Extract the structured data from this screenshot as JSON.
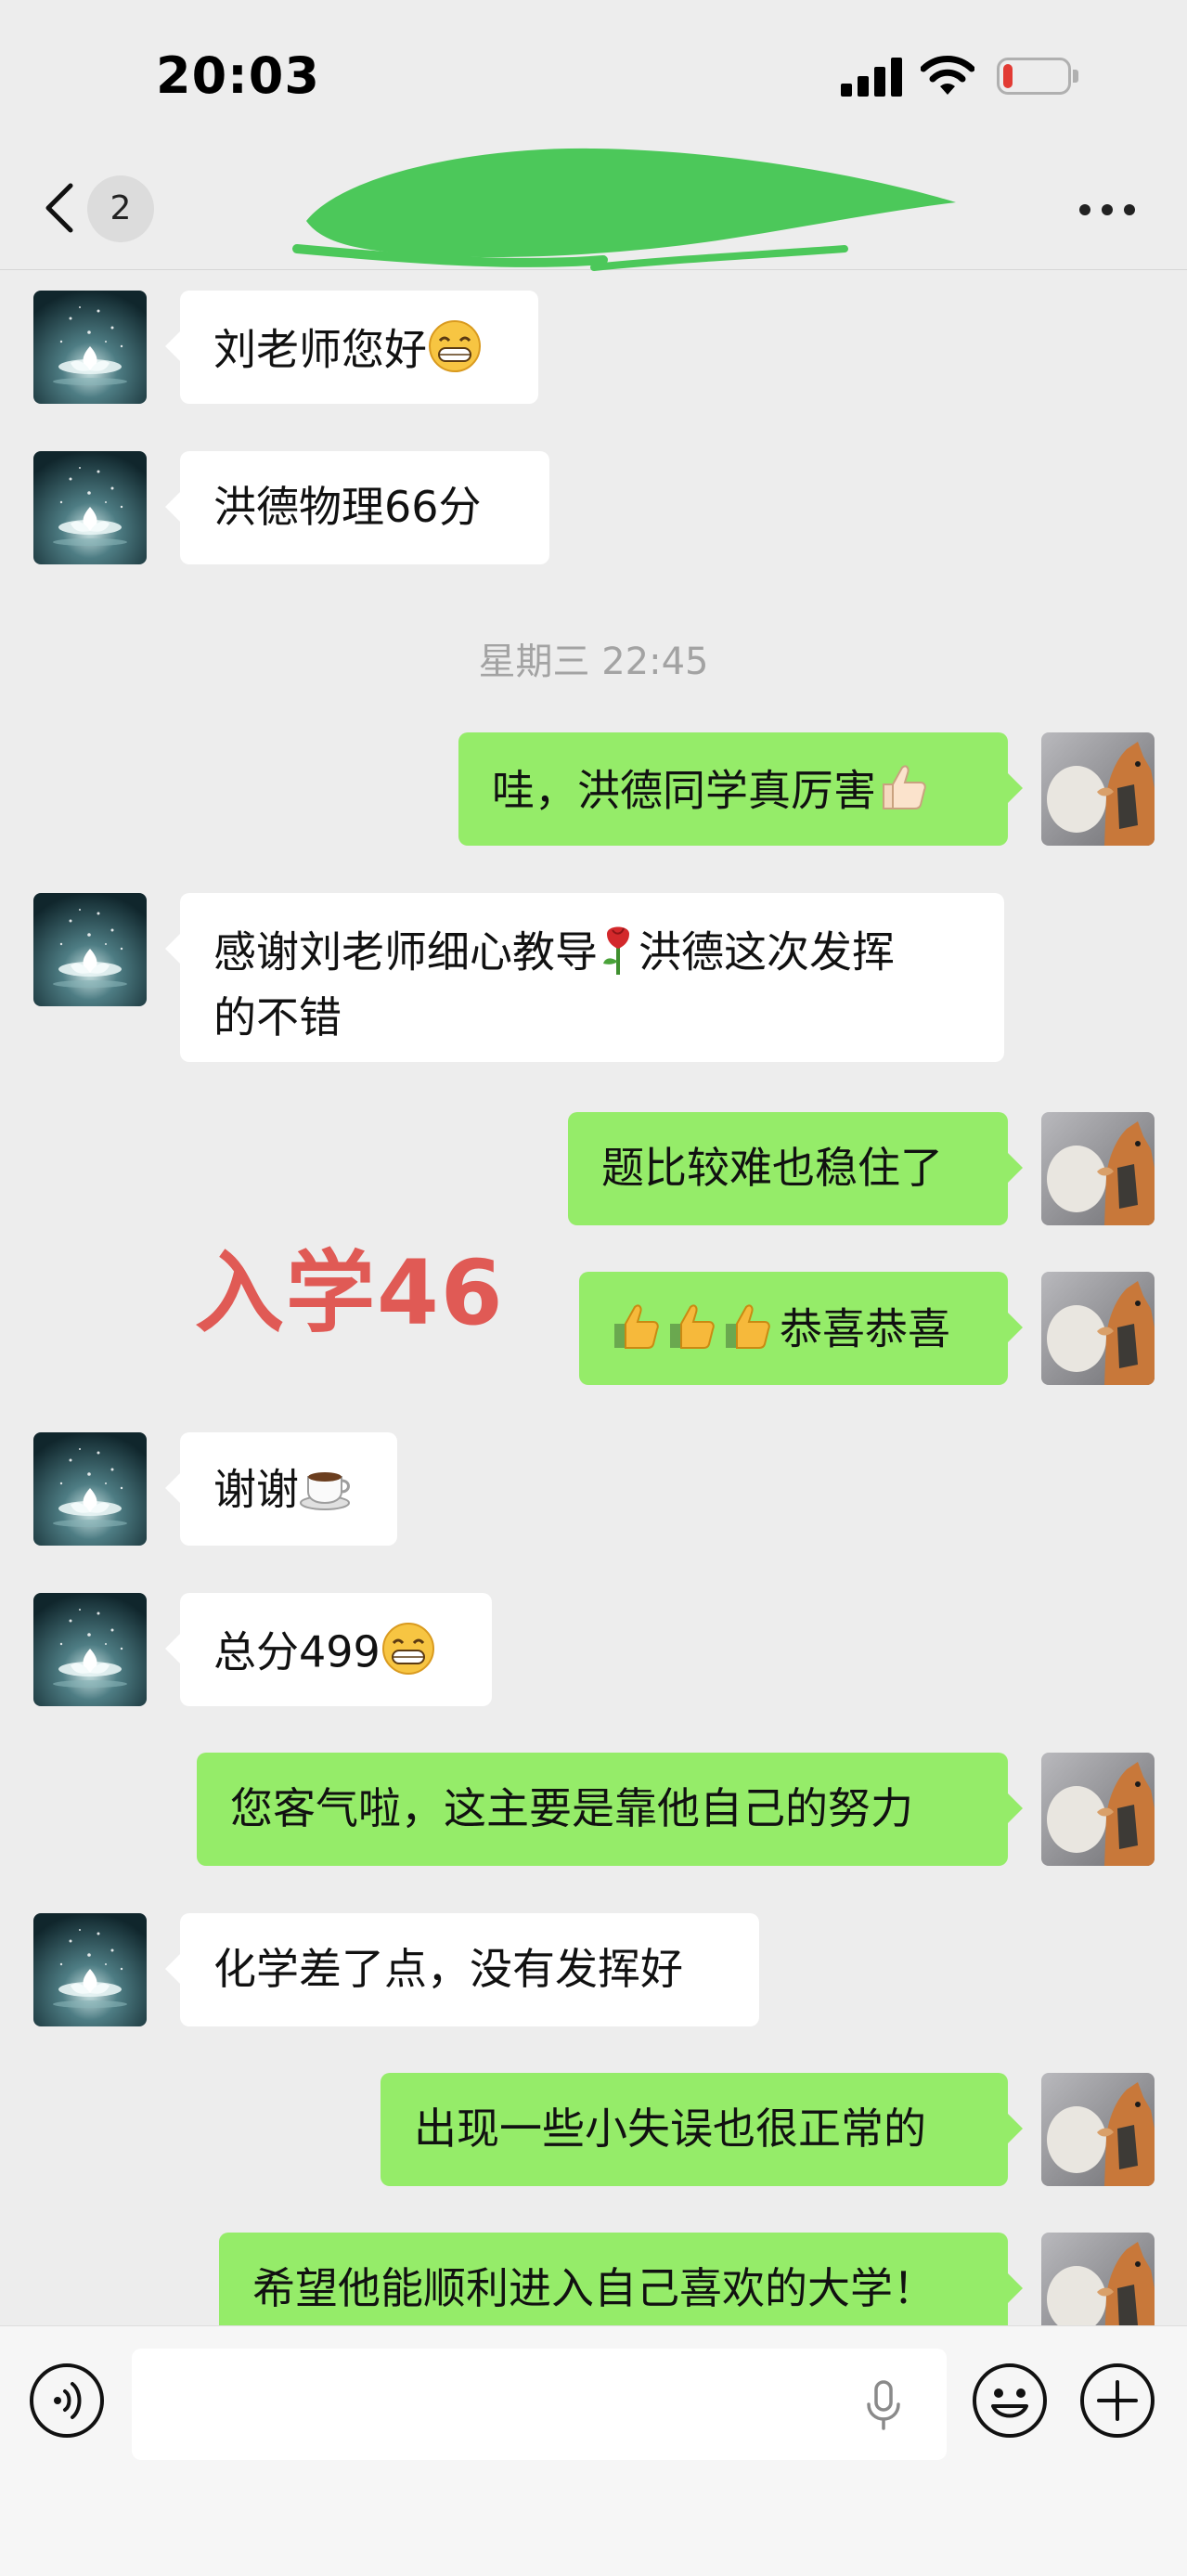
{
  "status_bar": {
    "time": "20:03",
    "battery_level": 0.15
  },
  "nav": {
    "unread_count": "2"
  },
  "timestamp": "星期三 22:45",
  "overlay_text": "入学46",
  "messages": [
    {
      "side": "in",
      "text": "刘老师您好",
      "emoji": "grin"
    },
    {
      "side": "in",
      "text": "洪德物理66分"
    },
    {
      "side": "out",
      "text": "哇，洪德同学真厉害",
      "emoji": "thumbs-up"
    },
    {
      "side": "in",
      "text_line1": "感谢刘老师细心教导",
      "text_line1_after": "洪德这次发挥",
      "text_line2": "的不错",
      "emoji": "rose"
    },
    {
      "side": "out",
      "text": "题比较难也稳住了"
    },
    {
      "side": "out",
      "text": "恭喜恭喜",
      "emoji": "thumbs-up-x3"
    },
    {
      "side": "in",
      "text": "谢谢",
      "emoji": "coffee"
    },
    {
      "side": "in",
      "text": "总分499",
      "emoji": "grin"
    },
    {
      "side": "out",
      "text": "您客气啦，这主要是靠他自己的努力"
    },
    {
      "side": "in",
      "text": "化学差了点，没有发挥好"
    },
    {
      "side": "out",
      "text": "出现一些小失误也很正常的"
    },
    {
      "side": "out",
      "text": "希望他能顺利进入自己喜欢的大学！"
    }
  ],
  "colors": {
    "background": "#ededed",
    "outgoing_bubble": "#95ec69",
    "incoming_bubble": "#ffffff",
    "overlay_text": "#e05a55",
    "redaction": "#4cc85a"
  }
}
